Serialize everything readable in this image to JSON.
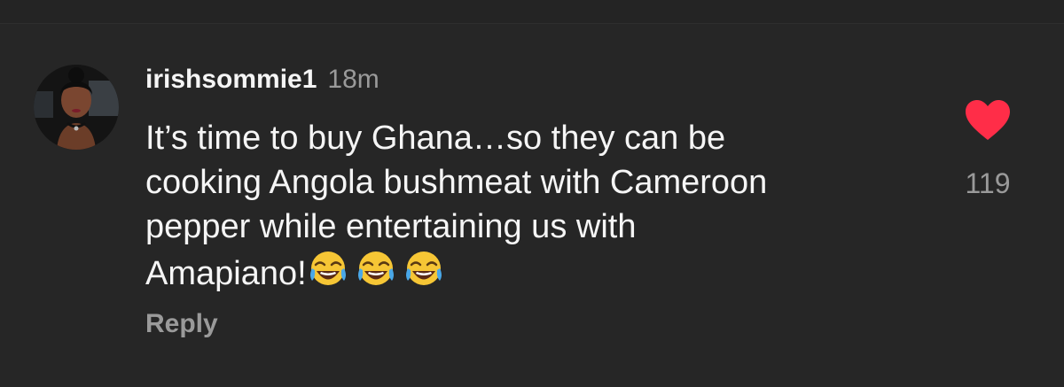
{
  "comment": {
    "username": "irishsommie1",
    "timestamp": "18m",
    "text_lines": [
      "It’s time to buy Ghana…so they can be",
      "cooking Angola bushmeat with Cameroon",
      "pepper while entertaining us with",
      "Amapiano!"
    ],
    "emojis": [
      "face-with-tears-of-joy",
      "face-with-tears-of-joy",
      "face-with-tears-of-joy"
    ],
    "reply_label": "Reply",
    "like_count": "119",
    "like_icon": "heart-icon",
    "liked": true
  },
  "colors": {
    "background": "#262626",
    "text_primary": "#f5f5f5",
    "text_secondary": "#9a9a9a",
    "like_red": "#ff2d48"
  }
}
